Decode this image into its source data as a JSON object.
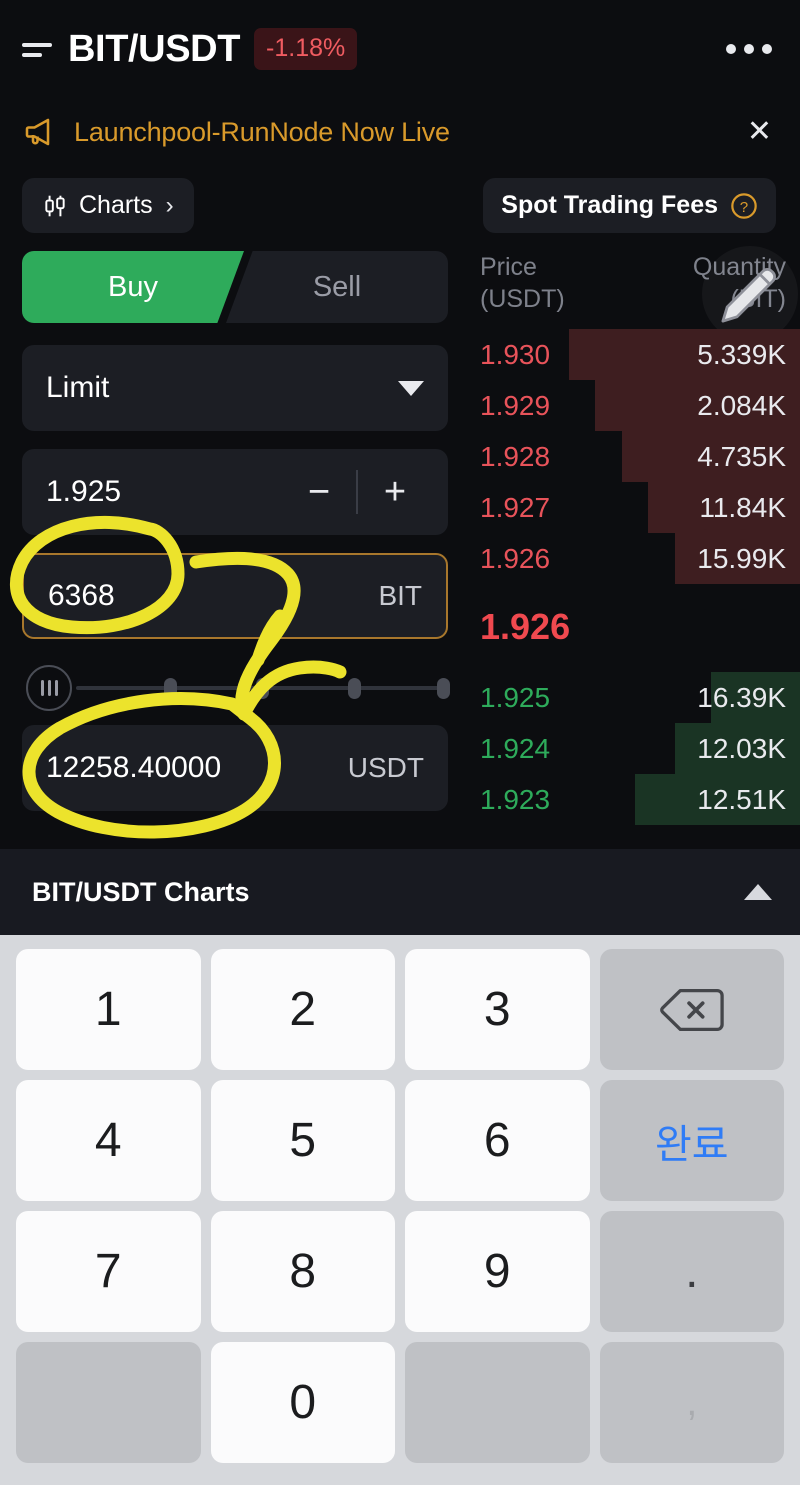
{
  "header": {
    "menu_icon": "list-menu-icon",
    "pair": "BIT/USDT",
    "change_pct": "-1.18%",
    "more_icon": "more-options-icon"
  },
  "announcement": {
    "icon": "megaphone-icon",
    "text": "Launchpool-RunNode Now Live",
    "close_icon": "close-icon"
  },
  "toolbar": {
    "charts_label": "Charts",
    "charts_icon": "candlestick-icon",
    "charts_chevron": "chevron-right-icon",
    "fees_label": "Spot Trading Fees",
    "fees_help_icon": "question-circle-icon"
  },
  "order_form": {
    "buy_label": "Buy",
    "sell_label": "Sell",
    "order_type": "Limit",
    "order_type_caret": "chevron-down-icon",
    "price_value": "1.925",
    "minus_label": "−",
    "plus_label": "+",
    "amount_value": "6368",
    "amount_unit": "BIT",
    "slider_grip_icon": "slider-grip-icon",
    "total_value": "12258.40000",
    "total_unit": "USDT"
  },
  "order_book": {
    "col_price_line1": "Price",
    "col_price_line2": "(USDT)",
    "col_qty_line1": "Quantity",
    "col_qty_line2": "(BIT)",
    "pencil_icon": "pencil-cursor-icon",
    "asks": [
      {
        "price": "1.930",
        "qty": "5.339K",
        "depth": 70
      },
      {
        "price": "1.929",
        "qty": "2.084K",
        "depth": 62
      },
      {
        "price": "1.928",
        "qty": "4.735K",
        "depth": 54
      },
      {
        "price": "1.927",
        "qty": "11.84K",
        "depth": 46
      },
      {
        "price": "1.926",
        "qty": "15.99K",
        "depth": 38
      }
    ],
    "mid_price": "1.926",
    "bids": [
      {
        "price": "1.925",
        "qty": "16.39K",
        "depth": 27
      },
      {
        "price": "1.924",
        "qty": "12.03K",
        "depth": 38
      },
      {
        "price": "1.923",
        "qty": "12.51K",
        "depth": 50
      }
    ]
  },
  "charts_panel": {
    "label": "BIT/USDT Charts",
    "collapse_icon": "chevron-up-icon"
  },
  "keypad": {
    "keys": [
      {
        "label": "1",
        "name": "key-1",
        "style": "light"
      },
      {
        "label": "2",
        "name": "key-2",
        "style": "light"
      },
      {
        "label": "3",
        "name": "key-3",
        "style": "light"
      },
      {
        "label": "",
        "name": "key-backspace",
        "style": "dark",
        "icon": "backspace-icon"
      },
      {
        "label": "4",
        "name": "key-4",
        "style": "light"
      },
      {
        "label": "5",
        "name": "key-5",
        "style": "light"
      },
      {
        "label": "6",
        "name": "key-6",
        "style": "light"
      },
      {
        "label": "완료",
        "name": "key-done",
        "style": "dark done"
      },
      {
        "label": "7",
        "name": "key-7",
        "style": "light"
      },
      {
        "label": "8",
        "name": "key-8",
        "style": "light"
      },
      {
        "label": "9",
        "name": "key-9",
        "style": "light"
      },
      {
        "label": ".",
        "name": "key-period",
        "style": "dark dot"
      },
      {
        "label": "",
        "name": "key-blank-left",
        "style": "dark"
      },
      {
        "label": "0",
        "name": "key-0",
        "style": "light"
      },
      {
        "label": "",
        "name": "key-blank-right",
        "style": "dark"
      },
      {
        "label": ",",
        "name": "key-comma",
        "style": "dark comma"
      }
    ]
  },
  "annotation": {
    "marker_color": "#ece32c",
    "shapes": "circle-around-amount, circle-around-total, arrow-linking-fields"
  },
  "colors": {
    "buy_green": "#2eab5b",
    "sell_red": "#e8535a",
    "accent_gold": "#d99a2b",
    "focus_border": "#a8772c",
    "bg": "#0c0d10",
    "field_bg": "#1c1e24"
  }
}
